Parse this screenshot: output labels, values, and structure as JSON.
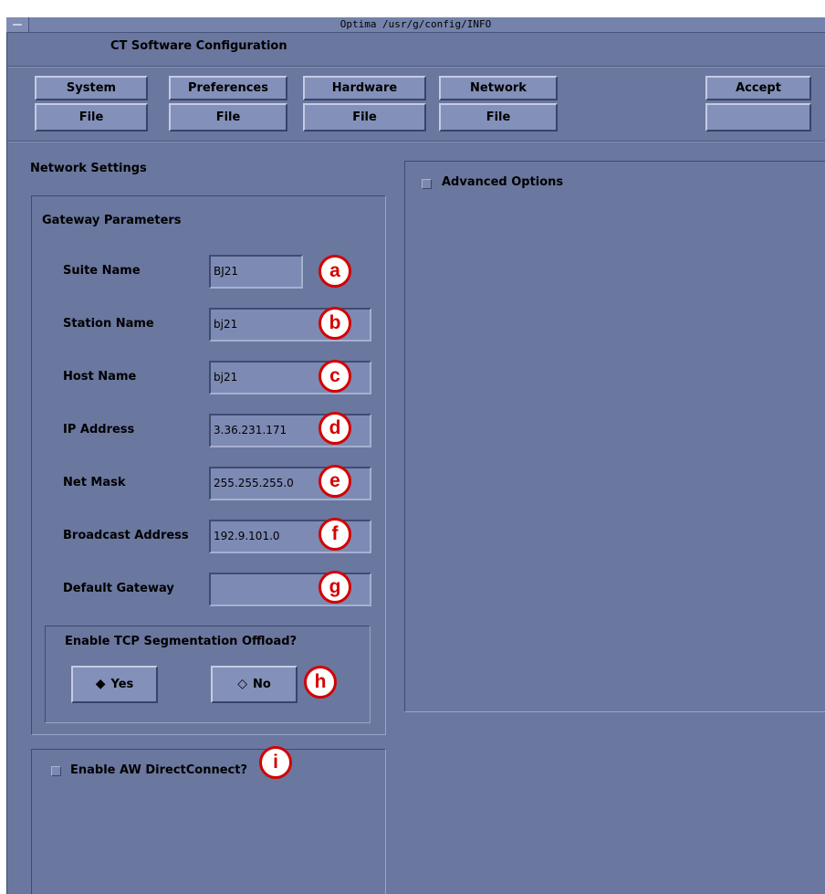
{
  "window": {
    "title": "Optima /usr/g/config/INFO",
    "app_title": "CT Software Configuration"
  },
  "toolbar": {
    "groups": [
      {
        "top": "System",
        "bottom": "File"
      },
      {
        "top": "Preferences",
        "bottom": "File"
      },
      {
        "top": "Hardware",
        "bottom": "File"
      },
      {
        "top": "Network",
        "bottom": "File"
      }
    ],
    "accept": "Accept"
  },
  "network": {
    "section_title": "Network Settings",
    "gateway": {
      "title": "Gateway Parameters",
      "fields": [
        {
          "label": "Suite Name",
          "value": "BJ21",
          "callout": "a"
        },
        {
          "label": "Station Name",
          "value": "bj21",
          "callout": "b"
        },
        {
          "label": "Host Name",
          "value": "bj21",
          "callout": "c"
        },
        {
          "label": "IP Address",
          "value": "3.36.231.171",
          "callout": "d"
        },
        {
          "label": "Net Mask",
          "value": "255.255.255.0",
          "callout": "e"
        },
        {
          "label": "Broadcast Address",
          "value": "192.9.101.0",
          "callout": "f"
        },
        {
          "label": "Default Gateway",
          "value": "",
          "callout": "g"
        }
      ]
    },
    "tcp": {
      "question": "Enable TCP Segmentation Offload?",
      "yes": "Yes",
      "no": "No",
      "selected": "Yes",
      "yes_glyph": "◆",
      "no_glyph": "◇",
      "callout": "h"
    },
    "aw": {
      "label": "Enable AW DirectConnect?",
      "checked": false,
      "callout": "i"
    },
    "advanced": {
      "label": "Advanced Options",
      "checked": false
    }
  },
  "colors": {
    "window_bg": "#6a779f",
    "button_bg": "#8390b9",
    "field_bg": "#7d8ab3",
    "callout": "#d40000"
  }
}
